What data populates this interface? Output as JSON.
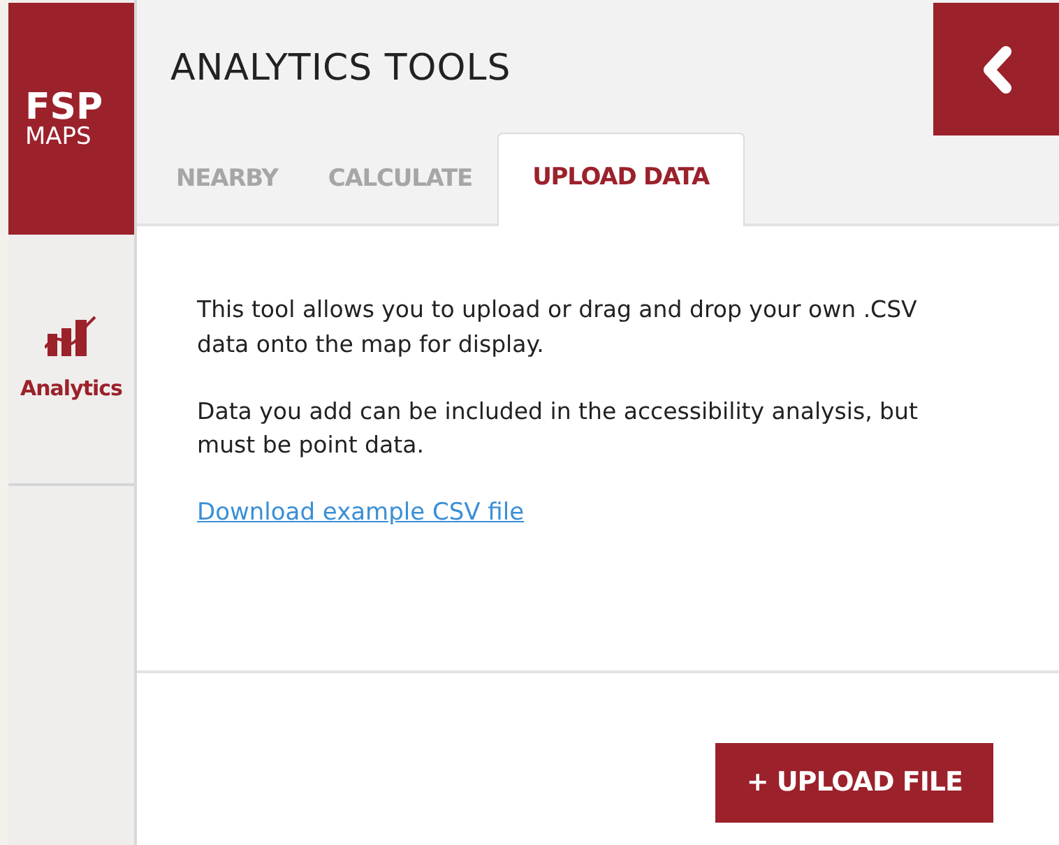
{
  "logo": {
    "title": "FSP",
    "subtitle": "MAPS"
  },
  "sidebar": {
    "items": [
      {
        "label": "Analytics",
        "selected": true
      }
    ]
  },
  "panel": {
    "title": "ANALYTICS TOOLS",
    "tabs": [
      {
        "label": "NEARBY",
        "selected": false
      },
      {
        "label": "CALCULATE",
        "selected": false
      },
      {
        "label": "UPLOAD DATA",
        "selected": true
      }
    ],
    "paragraphs": [
      "This tool allows you to upload or drag and drop your own .CSV data onto the map for display.",
      "Data you add can be included in the accessibility analysis, but must be point data."
    ],
    "link": "Download example CSV file",
    "button": "+ UPLOAD FILE"
  }
}
